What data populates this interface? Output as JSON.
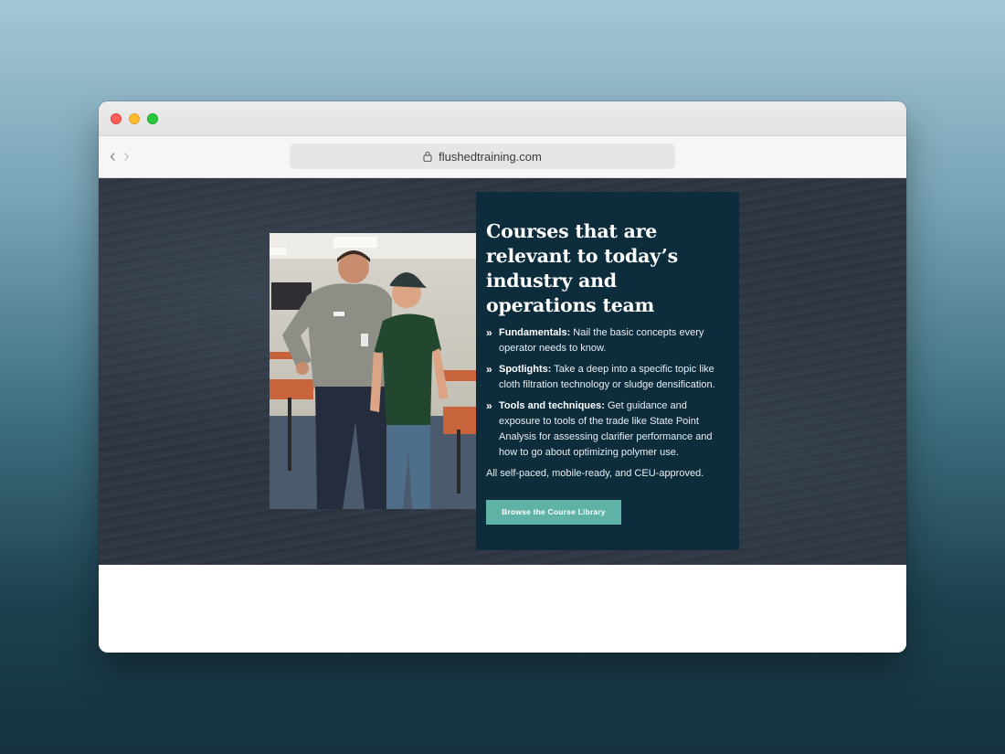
{
  "browser": {
    "url": "flushedtraining.com"
  },
  "hero": {
    "heading": "Courses that are relevant to today’s industry and operations team",
    "bullets": [
      {
        "title": "Fundamentals:",
        "text": " Nail the basic concepts every operator needs to know."
      },
      {
        "title": "Spotlights:",
        "text": " Take a deep into a specific topic like cloth filtration technology or sludge densification."
      },
      {
        "title": "Tools and techniques:",
        "text": " Get guidance and exposure to tools of the trade like State Point Analysis for assessing clarifier performance and how to go about optimizing polymer use."
      }
    ],
    "footnote": "All self-paced, mobile-ready, and CEU-approved.",
    "cta_label": "Browse the Course Library",
    "bullet_glyph": "»"
  },
  "nav": {
    "back_glyph": "‹",
    "forward_glyph": "›"
  },
  "colors": {
    "card_bg": "#0d2d3d",
    "cta_bg": "#5eb3a6"
  }
}
